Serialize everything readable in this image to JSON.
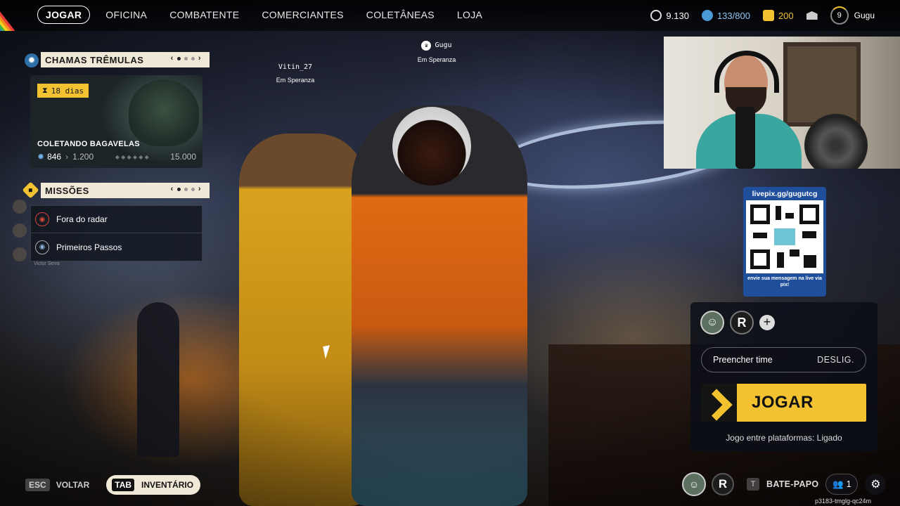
{
  "nav": {
    "items": [
      "JOGAR",
      "OFICINA",
      "COMBATENTE",
      "COMERCIANTES",
      "COLETÂNEAS",
      "LOJA"
    ],
    "active": "JOGAR"
  },
  "stats": {
    "currency1": "9.130",
    "currency2": "133/800",
    "currency3": "200",
    "level": "9",
    "username": "Gugu"
  },
  "event_panel": {
    "title": "CHAMAS TRÊMULAS",
    "days_left": "18 dias",
    "card_title": "COLETANDO BAGAVELAS",
    "progress_current": "846",
    "progress_next": "1.200",
    "progress_max": "15.000",
    "progress_fraction": 0.056
  },
  "missions_panel": {
    "title": "MISSÕES",
    "items": [
      "Fora do radar",
      "Primeiros Passos"
    ],
    "faint_name": "Victor Serra"
  },
  "players": [
    {
      "name": "Vitin_27",
      "location": "Em Speranza"
    },
    {
      "name": "Gugu",
      "location": "Em Speranza"
    }
  ],
  "qr": {
    "url": "livepix.gg/gugutcg",
    "caption": "envie sua mensagem na live via pix!"
  },
  "lobby": {
    "fill_team_label": "Preencher time",
    "fill_team_value": "DESLIG.",
    "play_label": "JOGAR",
    "crossplay": "Jogo entre plataformas: Ligado",
    "logo_glyph": "R",
    "add_glyph": "+"
  },
  "bottom": {
    "esc_key": "ESC",
    "back_label": "VOLTAR",
    "tab_key": "TAB",
    "inventory_label": "INVENTÁRIO",
    "chat_key": "T",
    "chat_label": "BATE-PAPO",
    "friends_count": "1",
    "session_id": "p3183-tmglg-qc24m"
  },
  "colors": {
    "accent_yellow": "#f2c230",
    "panel_cream": "#f1e9d8",
    "gear_blue": "#2f6fa8",
    "qr_blue": "#1f4f9a"
  },
  "icons": {
    "event": "gear-icon",
    "missions": "diamond-icon",
    "hourglass": "hourglass-icon",
    "crown": "crown-icon",
    "mail": "mail-icon",
    "friends": "friends-icon",
    "settings": "settings-icon"
  }
}
